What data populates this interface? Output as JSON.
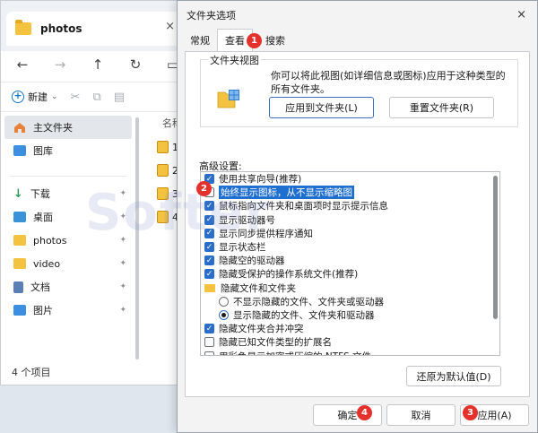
{
  "explorer": {
    "tab_title": "photos",
    "tab_close": "×",
    "nav": {
      "back": "←",
      "forward": "→",
      "up": "↑",
      "refresh": "↻",
      "view": "▭"
    },
    "toolbar": {
      "new_label": "新建",
      "new_chevron": "⌄"
    },
    "sidebar": [
      {
        "label": "主文件夹",
        "icon": "home-icon",
        "color": "#e8813a"
      },
      {
        "label": "图库",
        "icon": "gallery-icon",
        "color": "#3b8ee0"
      },
      {
        "label": "下载",
        "icon": "download-icon",
        "color": "#2f9a5a"
      },
      {
        "label": "桌面",
        "icon": "desktop-icon",
        "color": "#3a93d9"
      },
      {
        "label": "photos",
        "icon": "folder-icon",
        "color": "#f3c23f"
      },
      {
        "label": "video",
        "icon": "folder-icon",
        "color": "#f3c23f"
      },
      {
        "label": "文档",
        "icon": "documents-icon",
        "color": "#5a7fb6"
      },
      {
        "label": "图片",
        "icon": "pictures-icon",
        "color": "#3b8ee0"
      }
    ],
    "column_header": "名称",
    "files": [
      "1.",
      "2.",
      "3.",
      "4."
    ],
    "status": "4 个项目"
  },
  "dialog": {
    "title": "文件夹选项",
    "close": "×",
    "tabs": [
      "常规",
      "查看",
      "搜索"
    ],
    "folder_view": {
      "legend": "文件夹视图",
      "description": "你可以将此视图(如详细信息或图标)应用于这种类型的所有文件夹。",
      "apply_button": "应用到文件夹(L)",
      "reset_button": "重置文件夹(R)"
    },
    "advanced": {
      "label": "高级设置:",
      "items": [
        {
          "type": "checkbox",
          "checked": true,
          "label": "使用共享向导(推荐)"
        },
        {
          "type": "checkbox",
          "checked": false,
          "label": "始终显示图标，从不显示缩略图",
          "highlighted": true
        },
        {
          "type": "checkbox",
          "checked": true,
          "label": "鼠标指向文件夹和桌面项时显示提示信息"
        },
        {
          "type": "checkbox",
          "checked": true,
          "label": "显示驱动器号"
        },
        {
          "type": "checkbox",
          "checked": true,
          "label": "显示同步提供程序通知"
        },
        {
          "type": "checkbox",
          "checked": true,
          "label": "显示状态栏"
        },
        {
          "type": "checkbox",
          "checked": true,
          "label": "隐藏空的驱动器"
        },
        {
          "type": "checkbox",
          "checked": true,
          "label": "隐藏受保护的操作系统文件(推荐)"
        },
        {
          "type": "folder",
          "label": "隐藏文件和文件夹"
        },
        {
          "type": "radio",
          "checked": false,
          "label": "不显示隐藏的文件、文件夹或驱动器"
        },
        {
          "type": "radio",
          "checked": true,
          "label": "显示隐藏的文件、文件夹和驱动器"
        },
        {
          "type": "checkbox",
          "checked": true,
          "label": "隐藏文件夹合并冲突"
        },
        {
          "type": "checkbox",
          "checked": false,
          "label": "隐藏已知文件类型的扩展名"
        },
        {
          "type": "checkbox",
          "checked": false,
          "label": "用彩色显示加密或压缩的 NTFS 文件"
        }
      ]
    },
    "restore_button": "还原为默认值(D)",
    "footer": {
      "ok": "确定",
      "cancel": "取消",
      "apply": "应用(A)"
    }
  },
  "badges": [
    "1",
    "2",
    "3",
    "4"
  ],
  "watermark": "Softer",
  "colors": {
    "accent": "#2b6ec9",
    "badge": "#e4312b",
    "highlight": "#1f6fd1"
  }
}
